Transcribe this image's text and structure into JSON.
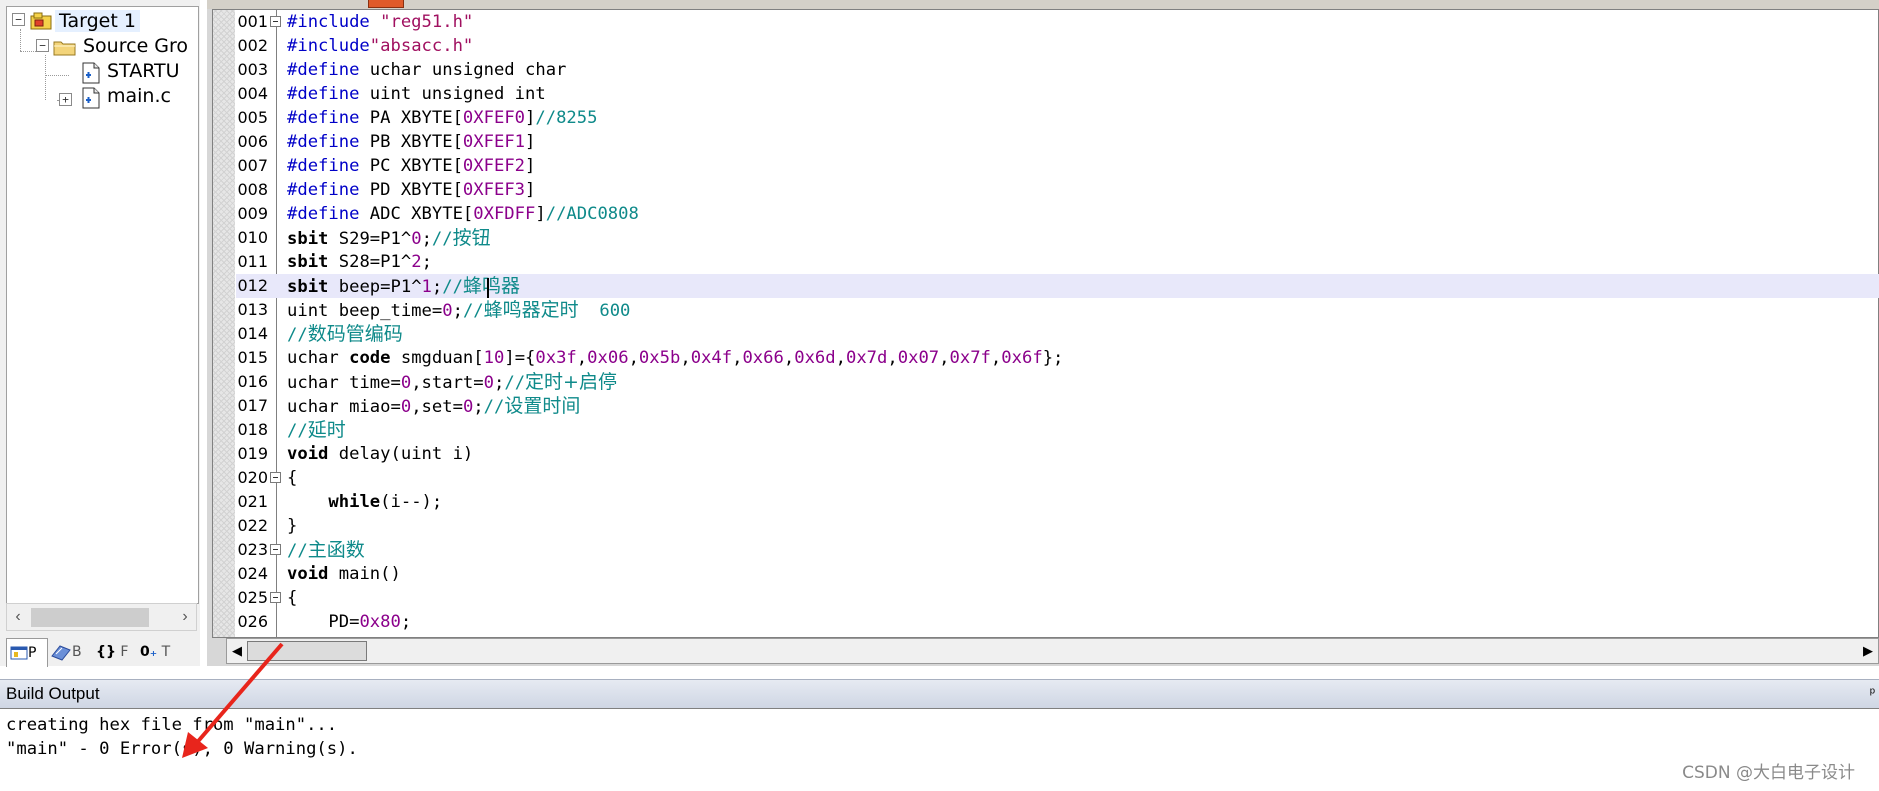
{
  "tree": {
    "items": [
      {
        "label": "Target 1"
      },
      {
        "label": "Source Gro"
      },
      {
        "label": "STARTU"
      },
      {
        "label": "main.c"
      }
    ],
    "tabs": [
      "P",
      "B",
      "F",
      "T"
    ]
  },
  "editor": {
    "highlighted_line": "012",
    "lines": [
      {
        "n": "001",
        "segs": [
          [
            "pp",
            "#include "
          ],
          [
            "str",
            "\"reg51.h\""
          ]
        ]
      },
      {
        "n": "002",
        "segs": [
          [
            "pp",
            "#include"
          ],
          [
            "str",
            "\"absacc.h\""
          ]
        ]
      },
      {
        "n": "003",
        "segs": [
          [
            "pp",
            "#define"
          ],
          [
            "tx",
            " uchar unsigned char"
          ]
        ]
      },
      {
        "n": "004",
        "segs": [
          [
            "pp",
            "#define"
          ],
          [
            "tx",
            " uint unsigned int"
          ]
        ]
      },
      {
        "n": "005",
        "segs": [
          [
            "pp",
            "#define"
          ],
          [
            "tx",
            " PA XBYTE["
          ],
          [
            "num",
            "0XFEF0"
          ],
          [
            "tx",
            "]"
          ],
          [
            "cm",
            "//8255"
          ]
        ]
      },
      {
        "n": "006",
        "segs": [
          [
            "pp",
            "#define"
          ],
          [
            "tx",
            " PB XBYTE["
          ],
          [
            "num",
            "0XFEF1"
          ],
          [
            "tx",
            "]"
          ]
        ]
      },
      {
        "n": "007",
        "segs": [
          [
            "pp",
            "#define"
          ],
          [
            "tx",
            " PC XBYTE["
          ],
          [
            "num",
            "0XFEF2"
          ],
          [
            "tx",
            "]"
          ]
        ]
      },
      {
        "n": "008",
        "segs": [
          [
            "pp",
            "#define"
          ],
          [
            "tx",
            " PD XBYTE["
          ],
          [
            "num",
            "0XFEF3"
          ],
          [
            "tx",
            "]"
          ]
        ]
      },
      {
        "n": "009",
        "segs": [
          [
            "pp",
            "#define"
          ],
          [
            "tx",
            " ADC XBYTE["
          ],
          [
            "num",
            "0XFDFF"
          ],
          [
            "tx",
            "]"
          ],
          [
            "cm",
            "//ADC0808"
          ]
        ]
      },
      {
        "n": "010",
        "segs": [
          [
            "kw",
            "sbit"
          ],
          [
            "tx",
            " S29=P1^"
          ],
          [
            "num",
            "0"
          ],
          [
            "tx",
            ";"
          ],
          [
            "cm",
            "//"
          ],
          [
            "cmz",
            "按钮"
          ]
        ]
      },
      {
        "n": "011",
        "segs": [
          [
            "kw",
            "sbit"
          ],
          [
            "tx",
            " S28=P1^"
          ],
          [
            "num",
            "2"
          ],
          [
            "tx",
            ";"
          ]
        ]
      },
      {
        "n": "012",
        "segs": [
          [
            "kw",
            "sbit"
          ],
          [
            "tx",
            " beep=P1^"
          ],
          [
            "num",
            "1"
          ],
          [
            "tx",
            ";"
          ],
          [
            "cm",
            "//"
          ],
          [
            "cmz",
            "蜂鸣器"
          ]
        ]
      },
      {
        "n": "013",
        "segs": [
          [
            "tx",
            "uint beep_time="
          ],
          [
            "num",
            "0"
          ],
          [
            "tx",
            ";"
          ],
          [
            "cm",
            "//"
          ],
          [
            "cmz",
            "蜂鸣器定时"
          ],
          [
            "cm",
            "  600"
          ]
        ]
      },
      {
        "n": "014",
        "segs": [
          [
            "cm",
            "//"
          ],
          [
            "cmz",
            "数码管编码"
          ]
        ]
      },
      {
        "n": "015",
        "segs": [
          [
            "tx",
            "uchar "
          ],
          [
            "kw",
            "code"
          ],
          [
            "tx",
            " smgduan["
          ],
          [
            "num",
            "10"
          ],
          [
            "tx",
            "]={"
          ],
          [
            "num",
            "0x3f"
          ],
          [
            "tx",
            ","
          ],
          [
            "num",
            "0x06"
          ],
          [
            "tx",
            ","
          ],
          [
            "num",
            "0x5b"
          ],
          [
            "tx",
            ","
          ],
          [
            "num",
            "0x4f"
          ],
          [
            "tx",
            ","
          ],
          [
            "num",
            "0x66"
          ],
          [
            "tx",
            ","
          ],
          [
            "num",
            "0x6d"
          ],
          [
            "tx",
            ","
          ],
          [
            "num",
            "0x7d"
          ],
          [
            "tx",
            ","
          ],
          [
            "num",
            "0x07"
          ],
          [
            "tx",
            ","
          ],
          [
            "num",
            "0x7f"
          ],
          [
            "tx",
            ","
          ],
          [
            "num",
            "0x6f"
          ],
          [
            "tx",
            "};"
          ]
        ]
      },
      {
        "n": "016",
        "segs": [
          [
            "tx",
            "uchar time="
          ],
          [
            "num",
            "0"
          ],
          [
            "tx",
            ",start="
          ],
          [
            "num",
            "0"
          ],
          [
            "tx",
            ";"
          ],
          [
            "cm",
            "//"
          ],
          [
            "cmz",
            "定时+启停"
          ]
        ]
      },
      {
        "n": "017",
        "segs": [
          [
            "tx",
            "uchar miao="
          ],
          [
            "num",
            "0"
          ],
          [
            "tx",
            ",set="
          ],
          [
            "num",
            "0"
          ],
          [
            "tx",
            ";"
          ],
          [
            "cm",
            "//"
          ],
          [
            "cmz",
            "设置时间"
          ]
        ]
      },
      {
        "n": "018",
        "segs": [
          [
            "cm",
            "//"
          ],
          [
            "cmz",
            "延时"
          ]
        ]
      },
      {
        "n": "019",
        "segs": [
          [
            "kw",
            "void"
          ],
          [
            "tx",
            " delay(uint i)"
          ]
        ]
      },
      {
        "n": "020",
        "segs": [
          [
            "tx",
            "{"
          ]
        ]
      },
      {
        "n": "021",
        "segs": [
          [
            "tx",
            "    "
          ],
          [
            "kw",
            "while"
          ],
          [
            "tx",
            "(i--);"
          ]
        ]
      },
      {
        "n": "022",
        "segs": [
          [
            "tx",
            "}"
          ]
        ]
      },
      {
        "n": "023",
        "segs": [
          [
            "cm",
            "//"
          ],
          [
            "cmz",
            "主函数"
          ]
        ]
      },
      {
        "n": "024",
        "segs": [
          [
            "kw",
            "void"
          ],
          [
            "tx",
            " main()"
          ]
        ]
      },
      {
        "n": "025",
        "segs": [
          [
            "tx",
            "{"
          ]
        ]
      },
      {
        "n": "026",
        "segs": [
          [
            "tx",
            "    PD="
          ],
          [
            "num",
            "0x80"
          ],
          [
            "tx",
            ";"
          ]
        ]
      }
    ]
  },
  "build_output": {
    "title": "Build Output",
    "pin": "ᵖ",
    "lines": [
      "creating hex file from \"main\"...",
      "\"main\" - 0 Error(s), 0 Warning(s)."
    ]
  },
  "watermark": "CSDN @大白电子设计",
  "colors": {
    "annotation_arrow": "#e8251c",
    "comment": "#0f8a8a",
    "preprocessor": "#0000c8",
    "string": "#a01060",
    "number": "#8b008b",
    "line_highlight": "#e8e8fa"
  },
  "icons": [
    "target-icon",
    "folder-icon",
    "file-icon",
    "project-tab-icon",
    "books-tab-icon",
    "functions-tab-icon",
    "templates-tab-icon",
    "pin-icon",
    "arrow-annotation"
  ]
}
